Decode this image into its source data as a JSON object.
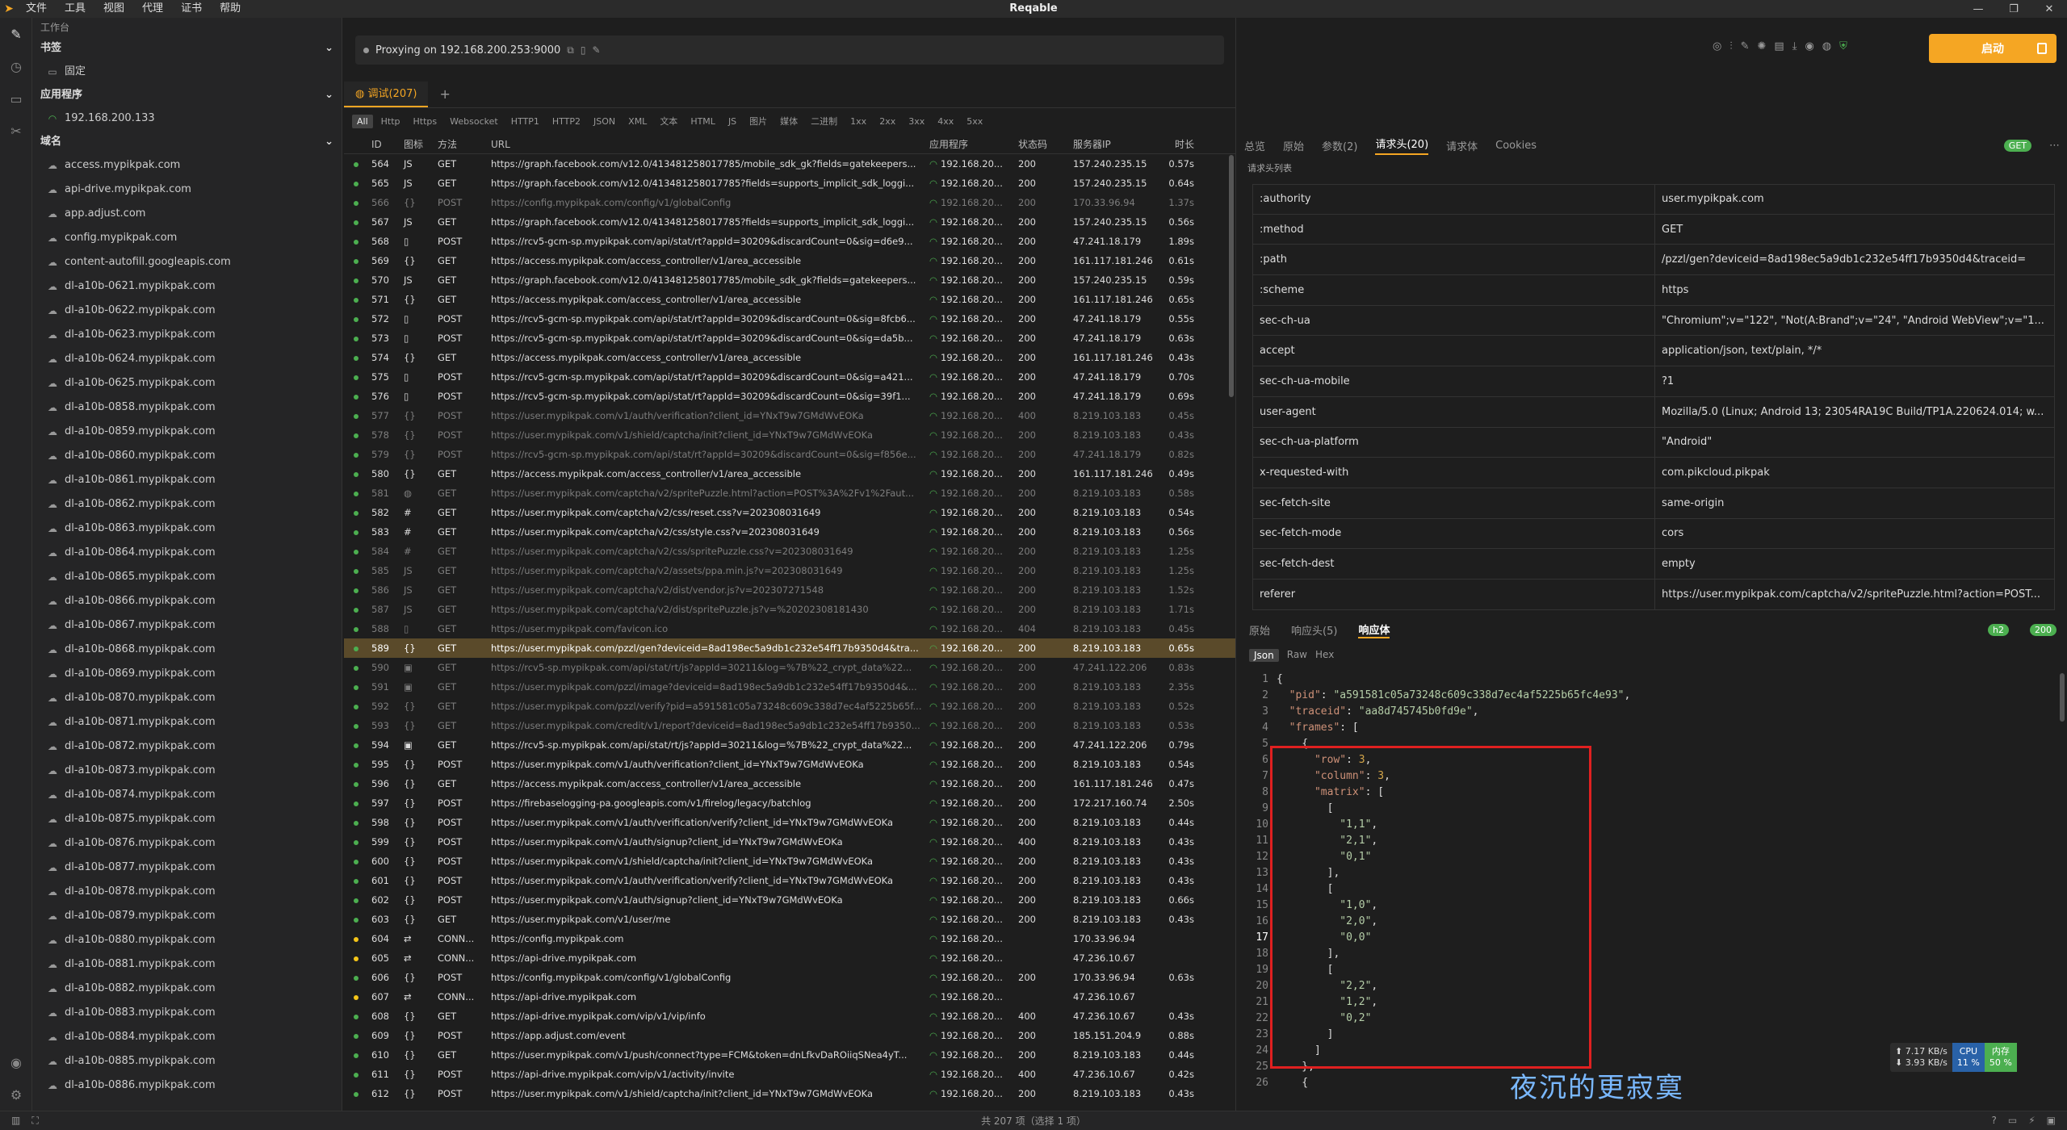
{
  "titlebar": {
    "title": "Reqable",
    "menu": [
      "文件",
      "工具",
      "视图",
      "代理",
      "证书",
      "帮助"
    ]
  },
  "sidebar": {
    "workspace": "工作台",
    "bookmarks": "书签",
    "pinned": "固定",
    "apps": "应用程序",
    "app_ip": "192.168.200.133",
    "domains_label": "域名",
    "domains": [
      "access.mypikpak.com",
      "api-drive.mypikpak.com",
      "app.adjust.com",
      "config.mypikpak.com",
      "content-autofill.googleapis.com",
      "dl-a10b-0621.mypikpak.com",
      "dl-a10b-0622.mypikpak.com",
      "dl-a10b-0623.mypikpak.com",
      "dl-a10b-0624.mypikpak.com",
      "dl-a10b-0625.mypikpak.com",
      "dl-a10b-0858.mypikpak.com",
      "dl-a10b-0859.mypikpak.com",
      "dl-a10b-0860.mypikpak.com",
      "dl-a10b-0861.mypikpak.com",
      "dl-a10b-0862.mypikpak.com",
      "dl-a10b-0863.mypikpak.com",
      "dl-a10b-0864.mypikpak.com",
      "dl-a10b-0865.mypikpak.com",
      "dl-a10b-0866.mypikpak.com",
      "dl-a10b-0867.mypikpak.com",
      "dl-a10b-0868.mypikpak.com",
      "dl-a10b-0869.mypikpak.com",
      "dl-a10b-0870.mypikpak.com",
      "dl-a10b-0871.mypikpak.com",
      "dl-a10b-0872.mypikpak.com",
      "dl-a10b-0873.mypikpak.com",
      "dl-a10b-0874.mypikpak.com",
      "dl-a10b-0875.mypikpak.com",
      "dl-a10b-0876.mypikpak.com",
      "dl-a10b-0877.mypikpak.com",
      "dl-a10b-0878.mypikpak.com",
      "dl-a10b-0879.mypikpak.com",
      "dl-a10b-0880.mypikpak.com",
      "dl-a10b-0881.mypikpak.com",
      "dl-a10b-0882.mypikpak.com",
      "dl-a10b-0883.mypikpak.com",
      "dl-a10b-0884.mypikpak.com",
      "dl-a10b-0885.mypikpak.com",
      "dl-a10b-0886.mypikpak.com"
    ]
  },
  "proxy": {
    "text": "Proxying on 192.168.200.253:9000"
  },
  "session_tab": "调试(207)",
  "filters": [
    "All",
    "Http",
    "Https",
    "Websocket",
    "HTTP1",
    "HTTP2",
    "JSON",
    "XML",
    "文本",
    "HTML",
    "JS",
    "图片",
    "媒体",
    "二进制",
    "1xx",
    "2xx",
    "3xx",
    "4xx",
    "5xx"
  ],
  "table": {
    "headers": [
      "ID",
      "图标",
      "方法",
      "URL",
      "应用程序",
      "状态码",
      "服务器IP",
      "时长"
    ],
    "rows": [
      [
        "564",
        "JS",
        "GET",
        "https://graph.facebook.com/v12.0/413481258017785/mobile_sdk_gk?fields=gatekeepers...",
        "192.168.20...",
        "200",
        "157.240.235.15",
        "0.57s",
        "g",
        ""
      ],
      [
        "565",
        "JS",
        "GET",
        "https://graph.facebook.com/v12.0/413481258017785?fields=supports_implicit_sdk_loggi...",
        "192.168.20...",
        "200",
        "157.240.235.15",
        "0.64s",
        "g",
        ""
      ],
      [
        "566",
        "{}",
        "POST",
        "https://config.mypikpak.com/config/v1/globalConfig",
        "192.168.20...",
        "200",
        "170.33.96.94",
        "1.37s",
        "g",
        "dim"
      ],
      [
        "567",
        "JS",
        "GET",
        "https://graph.facebook.com/v12.0/413481258017785?fields=supports_implicit_sdk_loggi...",
        "192.168.20...",
        "200",
        "157.240.235.15",
        "0.56s",
        "g",
        ""
      ],
      [
        "568",
        "▯",
        "POST",
        "https://rcv5-gcm-sp.mypikpak.com/api/stat/rt?appId=30209&discardCount=0&sig=d6e9...",
        "192.168.20...",
        "200",
        "47.241.18.179",
        "1.89s",
        "g",
        ""
      ],
      [
        "569",
        "{}",
        "GET",
        "https://access.mypikpak.com/access_controller/v1/area_accessible",
        "192.168.20...",
        "200",
        "161.117.181.246",
        "0.61s",
        "g",
        ""
      ],
      [
        "570",
        "JS",
        "GET",
        "https://graph.facebook.com/v12.0/413481258017785/mobile_sdk_gk?fields=gatekeepers...",
        "192.168.20...",
        "200",
        "157.240.235.15",
        "0.59s",
        "g",
        ""
      ],
      [
        "571",
        "{}",
        "GET",
        "https://access.mypikpak.com/access_controller/v1/area_accessible",
        "192.168.20...",
        "200",
        "161.117.181.246",
        "0.65s",
        "g",
        ""
      ],
      [
        "572",
        "▯",
        "POST",
        "https://rcv5-gcm-sp.mypikpak.com/api/stat/rt?appId=30209&discardCount=0&sig=8fcb6...",
        "192.168.20...",
        "200",
        "47.241.18.179",
        "0.55s",
        "g",
        ""
      ],
      [
        "573",
        "▯",
        "POST",
        "https://rcv5-gcm-sp.mypikpak.com/api/stat/rt?appId=30209&discardCount=0&sig=da5b...",
        "192.168.20...",
        "200",
        "47.241.18.179",
        "0.63s",
        "g",
        ""
      ],
      [
        "574",
        "{}",
        "GET",
        "https://access.mypikpak.com/access_controller/v1/area_accessible",
        "192.168.20...",
        "200",
        "161.117.181.246",
        "0.43s",
        "g",
        ""
      ],
      [
        "575",
        "▯",
        "POST",
        "https://rcv5-gcm-sp.mypikpak.com/api/stat/rt?appId=30209&discardCount=0&sig=a421...",
        "192.168.20...",
        "200",
        "47.241.18.179",
        "0.70s",
        "g",
        ""
      ],
      [
        "576",
        "▯",
        "POST",
        "https://rcv5-gcm-sp.mypikpak.com/api/stat/rt?appId=30209&discardCount=0&sig=39f1...",
        "192.168.20...",
        "200",
        "47.241.18.179",
        "0.69s",
        "g",
        ""
      ],
      [
        "577",
        "{}",
        "POST",
        "https://user.mypikpak.com/v1/auth/verification?client_id=YNxT9w7GMdWvEOKa",
        "192.168.20...",
        "400",
        "8.219.103.183",
        "0.45s",
        "g",
        "dim"
      ],
      [
        "578",
        "{}",
        "POST",
        "https://user.mypikpak.com/v1/shield/captcha/init?client_id=YNxT9w7GMdWvEOKa",
        "192.168.20...",
        "200",
        "8.219.103.183",
        "0.43s",
        "g",
        "dim"
      ],
      [
        "579",
        "{}",
        "POST",
        "https://rcv5-gcm-sp.mypikpak.com/api/stat/rt?appId=30209&discardCount=0&sig=f856e...",
        "192.168.20...",
        "200",
        "47.241.18.179",
        "0.82s",
        "g",
        "dim"
      ],
      [
        "580",
        "{}",
        "GET",
        "https://access.mypikpak.com/access_controller/v1/area_accessible",
        "192.168.20...",
        "200",
        "161.117.181.246",
        "0.49s",
        "g",
        ""
      ],
      [
        "581",
        "◍",
        "GET",
        "https://user.mypikpak.com/captcha/v2/spritePuzzle.html?action=POST%3A%2Fv1%2Faut...",
        "192.168.20...",
        "200",
        "8.219.103.183",
        "0.58s",
        "g",
        "dim"
      ],
      [
        "582",
        "#",
        "GET",
        "https://user.mypikpak.com/captcha/v2/css/reset.css?v=202308031649",
        "192.168.20...",
        "200",
        "8.219.103.183",
        "0.54s",
        "g",
        ""
      ],
      [
        "583",
        "#",
        "GET",
        "https://user.mypikpak.com/captcha/v2/css/style.css?v=202308031649",
        "192.168.20...",
        "200",
        "8.219.103.183",
        "0.56s",
        "g",
        ""
      ],
      [
        "584",
        "#",
        "GET",
        "https://user.mypikpak.com/captcha/v2/css/spritePuzzle.css?v=202308031649",
        "192.168.20...",
        "200",
        "8.219.103.183",
        "1.25s",
        "g",
        "dim"
      ],
      [
        "585",
        "JS",
        "GET",
        "https://user.mypikpak.com/captcha/v2/assets/ppa.min.js?v=202308031649",
        "192.168.20...",
        "200",
        "8.219.103.183",
        "1.25s",
        "g",
        "dim"
      ],
      [
        "586",
        "JS",
        "GET",
        "https://user.mypikpak.com/captcha/v2/dist/vendor.js?v=202307271548",
        "192.168.20...",
        "200",
        "8.219.103.183",
        "1.52s",
        "g",
        "dim"
      ],
      [
        "587",
        "JS",
        "GET",
        "https://user.mypikpak.com/captcha/v2/dist/spritePuzzle.js?v=%20202308181430",
        "192.168.20...",
        "200",
        "8.219.103.183",
        "1.71s",
        "g",
        "dim"
      ],
      [
        "588",
        "▯",
        "GET",
        "https://user.mypikpak.com/favicon.ico",
        "192.168.20...",
        "404",
        "8.219.103.183",
        "0.45s",
        "g",
        "dim"
      ],
      [
        "589",
        "{}",
        "GET",
        "https://user.mypikpak.com/pzzl/gen?deviceid=8ad198ec5a9db1c232e54ff17b9350d4&tra...",
        "192.168.20...",
        "200",
        "8.219.103.183",
        "0.65s",
        "g",
        "sel"
      ],
      [
        "590",
        "▣",
        "GET",
        "https://rcv5-sp.mypikpak.com/api/stat/rt/js?appId=30211&log=%7B%22_crypt_data%22...",
        "192.168.20...",
        "200",
        "47.241.122.206",
        "0.83s",
        "g",
        "dim"
      ],
      [
        "591",
        "▣",
        "GET",
        "https://user.mypikpak.com/pzzl/image?deviceid=8ad198ec5a9db1c232e54ff17b9350d4&...",
        "192.168.20...",
        "200",
        "8.219.103.183",
        "2.35s",
        "g",
        "dim"
      ],
      [
        "592",
        "{}",
        "GET",
        "https://user.mypikpak.com/pzzl/verify?pid=a591581c05a73248c609c338d7ec4af5225b65f...",
        "192.168.20...",
        "200",
        "8.219.103.183",
        "0.52s",
        "g",
        "dim"
      ],
      [
        "593",
        "{}",
        "GET",
        "https://user.mypikpak.com/credit/v1/report?deviceid=8ad198ec5a9db1c232e54ff17b9350...",
        "192.168.20...",
        "200",
        "8.219.103.183",
        "0.53s",
        "g",
        "dim"
      ],
      [
        "594",
        "▣",
        "GET",
        "https://rcv5-sp.mypikpak.com/api/stat/rt/js?appId=30211&log=%7B%22_crypt_data%22...",
        "192.168.20...",
        "200",
        "47.241.122.206",
        "0.79s",
        "g",
        ""
      ],
      [
        "595",
        "{}",
        "POST",
        "https://user.mypikpak.com/v1/auth/verification?client_id=YNxT9w7GMdWvEOKa",
        "192.168.20...",
        "200",
        "8.219.103.183",
        "0.54s",
        "g",
        ""
      ],
      [
        "596",
        "{}",
        "GET",
        "https://access.mypikpak.com/access_controller/v1/area_accessible",
        "192.168.20...",
        "200",
        "161.117.181.246",
        "0.47s",
        "g",
        ""
      ],
      [
        "597",
        "{}",
        "POST",
        "https://firebaselogging-pa.googleapis.com/v1/firelog/legacy/batchlog",
        "192.168.20...",
        "200",
        "172.217.160.74",
        "2.50s",
        "g",
        ""
      ],
      [
        "598",
        "{}",
        "POST",
        "https://user.mypikpak.com/v1/auth/verification/verify?client_id=YNxT9w7GMdWvEOKa",
        "192.168.20...",
        "200",
        "8.219.103.183",
        "0.44s",
        "g",
        ""
      ],
      [
        "599",
        "{}",
        "POST",
        "https://user.mypikpak.com/v1/auth/signup?client_id=YNxT9w7GMdWvEOKa",
        "192.168.20...",
        "400",
        "8.219.103.183",
        "0.43s",
        "g",
        ""
      ],
      [
        "600",
        "{}",
        "POST",
        "https://user.mypikpak.com/v1/shield/captcha/init?client_id=YNxT9w7GMdWvEOKa",
        "192.168.20...",
        "200",
        "8.219.103.183",
        "0.43s",
        "g",
        ""
      ],
      [
        "601",
        "{}",
        "POST",
        "https://user.mypikpak.com/v1/auth/verification/verify?client_id=YNxT9w7GMdWvEOKa",
        "192.168.20...",
        "200",
        "8.219.103.183",
        "0.43s",
        "g",
        ""
      ],
      [
        "602",
        "{}",
        "POST",
        "https://user.mypikpak.com/v1/auth/signup?client_id=YNxT9w7GMdWvEOKa",
        "192.168.20...",
        "200",
        "8.219.103.183",
        "0.66s",
        "g",
        ""
      ],
      [
        "603",
        "{}",
        "GET",
        "https://user.mypikpak.com/v1/user/me",
        "192.168.20...",
        "200",
        "8.219.103.183",
        "0.43s",
        "g",
        ""
      ],
      [
        "604",
        "⇄",
        "CONN...",
        "https://config.mypikpak.com",
        "192.168.20...",
        "",
        "170.33.96.94",
        "",
        "y",
        ""
      ],
      [
        "605",
        "⇄",
        "CONN...",
        "https://api-drive.mypikpak.com",
        "192.168.20...",
        "",
        "47.236.10.67",
        "",
        "y",
        ""
      ],
      [
        "606",
        "{}",
        "POST",
        "https://config.mypikpak.com/config/v1/globalConfig",
        "192.168.20...",
        "200",
        "170.33.96.94",
        "0.63s",
        "g",
        ""
      ],
      [
        "607",
        "⇄",
        "CONN...",
        "https://api-drive.mypikpak.com",
        "192.168.20...",
        "",
        "47.236.10.67",
        "",
        "y",
        ""
      ],
      [
        "608",
        "{}",
        "GET",
        "https://api-drive.mypikpak.com/vip/v1/vip/info",
        "192.168.20...",
        "400",
        "47.236.10.67",
        "0.43s",
        "g",
        ""
      ],
      [
        "609",
        "{}",
        "POST",
        "https://app.adjust.com/event",
        "192.168.20...",
        "200",
        "185.151.204.9",
        "0.88s",
        "g",
        ""
      ],
      [
        "610",
        "{}",
        "GET",
        "https://user.mypikpak.com/v1/push/connect?type=FCM&token=dnLfkvDaROiiqSNea4yT...",
        "192.168.20...",
        "200",
        "8.219.103.183",
        "0.44s",
        "g",
        ""
      ],
      [
        "611",
        "{}",
        "POST",
        "https://api-drive.mypikpak.com/vip/v1/activity/invite",
        "192.168.20...",
        "400",
        "47.236.10.67",
        "0.42s",
        "g",
        ""
      ],
      [
        "612",
        "{}",
        "POST",
        "https://user.mypikpak.com/v1/shield/captcha/init?client_id=YNxT9w7GMdWvEOKa",
        "192.168.20...",
        "200",
        "8.219.103.183",
        "0.43s",
        "g",
        ""
      ]
    ]
  },
  "right": {
    "start_label": "启动",
    "tabs": [
      "总览",
      "原始",
      "参数(2)",
      "请求头(20)",
      "请求体",
      "Cookies"
    ],
    "method_badge": "GET",
    "header_list_label": "请求头列表",
    "headers": [
      [
        ":authority",
        "user.mypikpak.com"
      ],
      [
        ":method",
        "GET"
      ],
      [
        ":path",
        "/pzzl/gen?deviceid=8ad198ec5a9db1c232e54ff17b9350d4&traceid="
      ],
      [
        ":scheme",
        "https"
      ],
      [
        "sec-ch-ua",
        "\"Chromium\";v=\"122\", \"Not(A:Brand\";v=\"24\", \"Android WebView\";v=\"1..."
      ],
      [
        "accept",
        "application/json, text/plain, */*"
      ],
      [
        "sec-ch-ua-mobile",
        "?1"
      ],
      [
        "user-agent",
        "Mozilla/5.0 (Linux; Android 13; 23054RA19C Build/TP1A.220624.014; w..."
      ],
      [
        "sec-ch-ua-platform",
        "\"Android\""
      ],
      [
        "x-requested-with",
        "com.pikcloud.pikpak"
      ],
      [
        "sec-fetch-site",
        "same-origin"
      ],
      [
        "sec-fetch-mode",
        "cors"
      ],
      [
        "sec-fetch-dest",
        "empty"
      ],
      [
        "referer",
        "https://user.mypikpak.com/captcha/v2/spritePuzzle.html?action=POST..."
      ]
    ],
    "resp_tabs": [
      "原始",
      "响应头(5)",
      "响应体"
    ],
    "h2": "h2",
    "status": "200",
    "formats": [
      "Json",
      "Raw",
      "Hex"
    ],
    "code": [
      [
        "1",
        "{"
      ],
      [
        "2",
        "  \"pid\": \"a591581c05a73248c609c338d7ec4af5225b65fc4e93\","
      ],
      [
        "3",
        "  \"traceid\": \"aa8d745745b0fd9e\","
      ],
      [
        "4",
        "  \"frames\": ["
      ],
      [
        "5",
        "    {"
      ],
      [
        "6",
        "      \"row\": 3,"
      ],
      [
        "7",
        "      \"column\": 3,"
      ],
      [
        "8",
        "      \"matrix\": ["
      ],
      [
        "9",
        "        ["
      ],
      [
        "10",
        "          \"1,1\","
      ],
      [
        "11",
        "          \"2,1\","
      ],
      [
        "12",
        "          \"0,1\""
      ],
      [
        "13",
        "        ],"
      ],
      [
        "14",
        "        ["
      ],
      [
        "15",
        "          \"1,0\","
      ],
      [
        "16",
        "          \"2,0\","
      ],
      [
        "17",
        "          \"0,0\""
      ],
      [
        "18",
        "        ],"
      ],
      [
        "19",
        "        ["
      ],
      [
        "20",
        "          \"2,2\","
      ],
      [
        "21",
        "          \"1,2\","
      ],
      [
        "22",
        "          \"0,2\""
      ],
      [
        "23",
        "        ]"
      ],
      [
        "24",
        "      ]"
      ],
      [
        "25",
        "    },"
      ],
      [
        "26",
        "    {"
      ]
    ],
    "stats": {
      "up": "7.17 KB/s",
      "down": "3.93 KB/s",
      "cpu_label": "CPU",
      "cpu": "11 %",
      "mem_label": "内存",
      "mem": "50 %"
    }
  },
  "watermark": "夜沉的更寂寞",
  "statusbar": {
    "text": "共 207 项（选择 1 项）"
  }
}
